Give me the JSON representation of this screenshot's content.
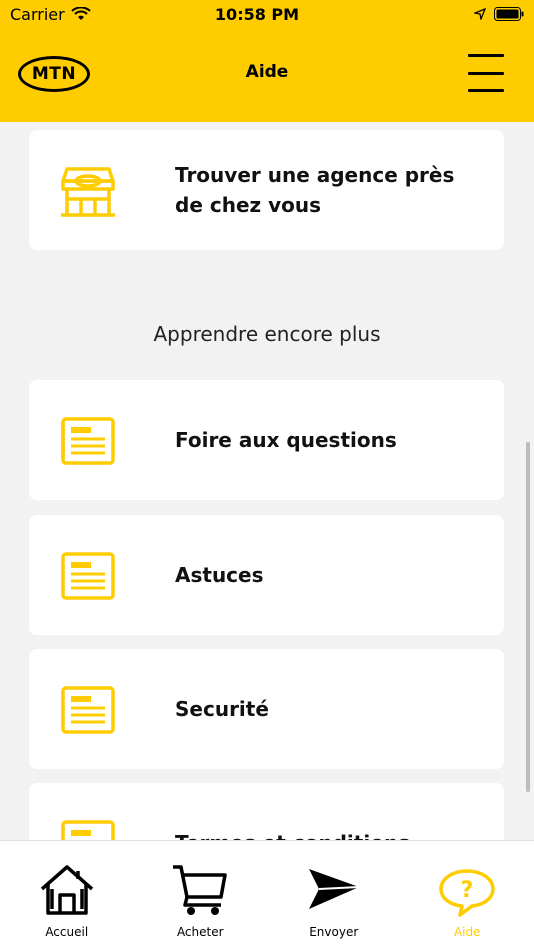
{
  "status_bar": {
    "carrier": "Carrier",
    "time": "10:58 PM"
  },
  "header": {
    "logo_text": "MTN",
    "title": "Aide"
  },
  "cards": [
    {
      "label": "Trouver une agence près de chez vous",
      "icon": "store-icon"
    },
    {
      "label": "Foire aux questions",
      "icon": "document-icon"
    },
    {
      "label": "Astuces",
      "icon": "document-icon"
    },
    {
      "label": "Securité",
      "icon": "document-icon"
    },
    {
      "label": "Termes et conditions",
      "icon": "document-icon"
    }
  ],
  "section_title": "Apprendre encore plus",
  "tabs": [
    {
      "label": "Accueil",
      "icon": "home-icon",
      "active": false
    },
    {
      "label": "Acheter",
      "icon": "cart-icon",
      "active": false
    },
    {
      "label": "Envoyer",
      "icon": "send-icon",
      "active": false
    },
    {
      "label": "Aide",
      "icon": "help-icon",
      "active": true
    }
  ],
  "colors": {
    "brand": "#ffcc00",
    "background": "#f2f2f2",
    "card": "#ffffff"
  }
}
